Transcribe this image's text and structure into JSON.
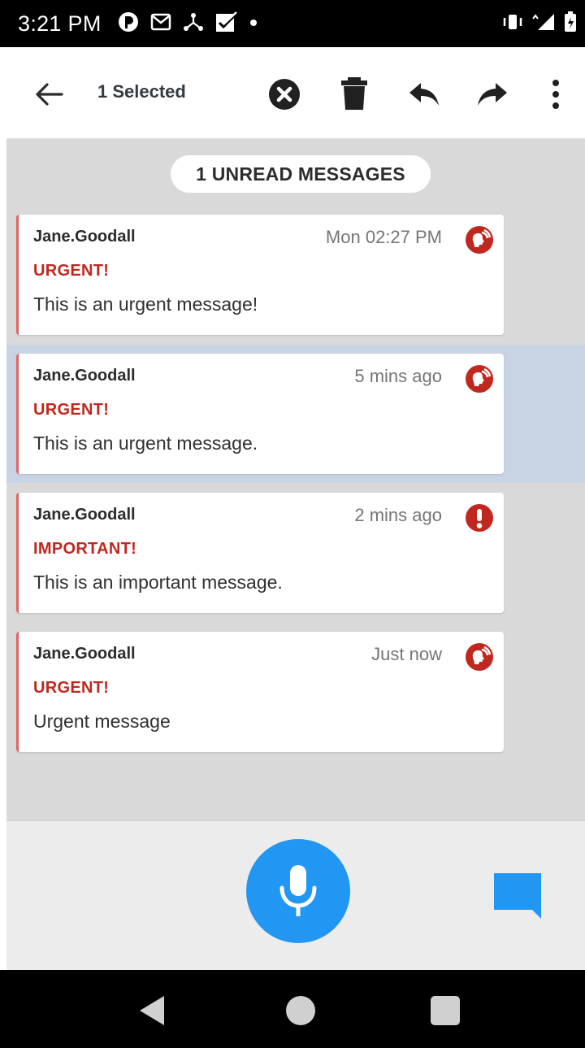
{
  "status_bar": {
    "time": "3:21 PM",
    "left_icons": [
      "pocket-app-icon",
      "gmail-icon",
      "network-icon",
      "checkbox-icon",
      "dot-icon"
    ],
    "right_icons": [
      "vibrate-icon",
      "signal-icon",
      "battery-icon"
    ]
  },
  "toolbar": {
    "selected_label": "1 Selected",
    "actions": [
      "back-arrow-icon",
      "cancel-icon",
      "delete-icon",
      "reply-icon",
      "forward-icon",
      "more-vert-icon"
    ]
  },
  "unread_banner": "1 UNREAD MESSAGES",
  "messages": [
    {
      "sender": "Jane.Goodall",
      "time": "Mon 02:27 PM",
      "priority": "URGENT!",
      "body": "This is an urgent message!",
      "icon": "urgent-speaker-icon",
      "selected": false
    },
    {
      "sender": "Jane.Goodall",
      "time": "5 mins ago",
      "priority": "URGENT!",
      "body": "This is an urgent message.",
      "icon": "urgent-speaker-icon",
      "selected": true
    },
    {
      "sender": "Jane.Goodall",
      "time": "2 mins ago",
      "priority": "IMPORTANT!",
      "body": "This is an important message.",
      "icon": "important-exclamation-icon",
      "selected": false
    },
    {
      "sender": "Jane.Goodall",
      "time": "Just now",
      "priority": "URGENT!",
      "body": "Urgent message",
      "icon": "urgent-speaker-icon",
      "selected": false
    }
  ],
  "bottom_actions": [
    "microphone-icon",
    "chat-bubble-icon"
  ],
  "nav_bar": [
    "nav-back-icon",
    "nav-home-icon",
    "nav-recents-icon"
  ],
  "colors": {
    "urgent_red": "#c0281f",
    "accent_blue": "#2196f3",
    "selected_row": "#c8d4e3",
    "list_background": "#d9d9d9"
  }
}
